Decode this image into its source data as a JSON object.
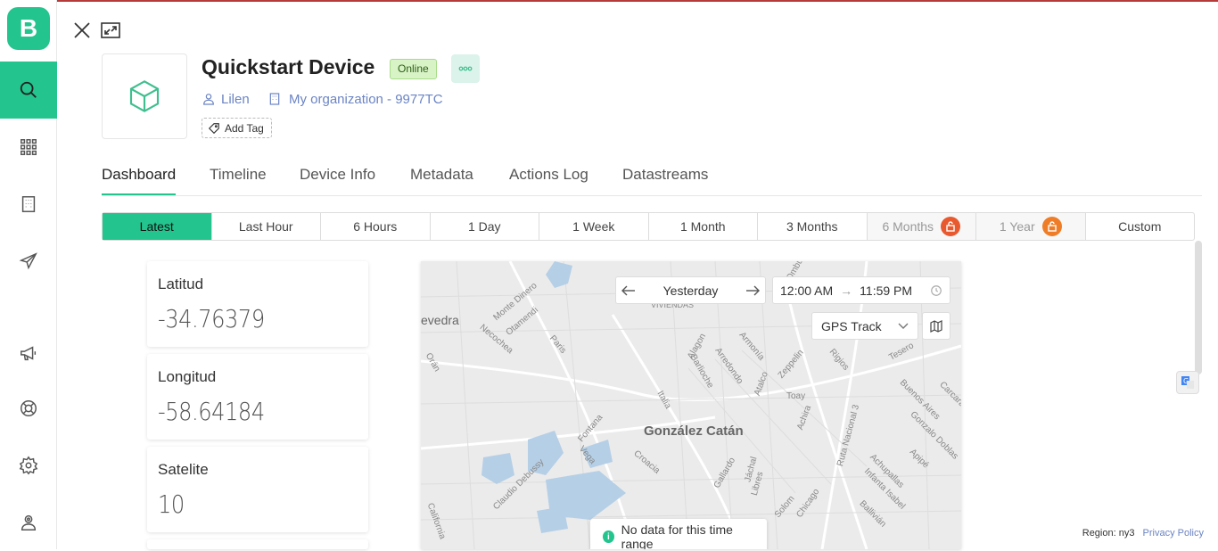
{
  "app": {
    "logo_letter": "B"
  },
  "sidebar": {
    "items": [
      {
        "name": "search",
        "icon": "search-icon",
        "active": true
      },
      {
        "name": "devices",
        "icon": "grid-icon",
        "active": false
      },
      {
        "name": "organizations",
        "icon": "building-icon",
        "active": false
      },
      {
        "name": "messages",
        "icon": "send-icon",
        "active": false
      },
      {
        "name": "announcements",
        "icon": "megaphone-icon",
        "active": false
      },
      {
        "name": "help",
        "icon": "lifebuoy-icon",
        "active": false
      },
      {
        "name": "settings",
        "icon": "gear-icon",
        "active": false
      },
      {
        "name": "profile",
        "icon": "user-badge-icon",
        "active": false
      }
    ]
  },
  "device": {
    "title": "Quickstart Device",
    "status": "Online",
    "owner": "Lilen",
    "organization": "My organization - 9977TC",
    "add_tag": "Add Tag"
  },
  "tabs": [
    "Dashboard",
    "Timeline",
    "Device Info",
    "Metadata",
    "Actions Log",
    "Datastreams"
  ],
  "active_tab": "Dashboard",
  "time_ranges": [
    {
      "label": "Latest",
      "active": true,
      "locked": false
    },
    {
      "label": "Last Hour",
      "active": false,
      "locked": false
    },
    {
      "label": "6 Hours",
      "active": false,
      "locked": false
    },
    {
      "label": "1 Day",
      "active": false,
      "locked": false
    },
    {
      "label": "1 Week",
      "active": false,
      "locked": false
    },
    {
      "label": "1 Month",
      "active": false,
      "locked": false
    },
    {
      "label": "3 Months",
      "active": false,
      "locked": false
    },
    {
      "label": "6 Months",
      "active": false,
      "locked": true
    },
    {
      "label": "1 Year",
      "active": false,
      "locked": true
    },
    {
      "label": "Custom",
      "active": false,
      "locked": false
    }
  ],
  "cards": [
    {
      "label": "Latitud",
      "value": "-34.76379"
    },
    {
      "label": "Longitud",
      "value": "-58.64184"
    },
    {
      "label": "Satelite",
      "value": "10"
    }
  ],
  "map": {
    "date": "Yesterday",
    "time_from": "12:00 AM",
    "time_to": "11:59 PM",
    "track_mode": "GPS Track",
    "nodata": "No data for this time range",
    "city_label": "González Catán",
    "place_labels": [
      "evedra",
      "Necochea",
      "Monte Dinero",
      "Otamendi",
      "Paris",
      "Orán",
      "Italia",
      "Fontana",
      "Vega",
      "Croacia",
      "Claudio Debussy",
      "Alagon",
      "Barlioche",
      "Arredondo",
      "Armonía",
      "Atalco",
      "Zeppelin",
      "Rigios",
      "Toay",
      "Achira",
      "Ruta Nacional 3",
      "Buenos Aires",
      "Gonzalo Doblas",
      "Achupallas",
      "Infanta Isabel",
      "Ballivián",
      "Gallardo",
      "Jáchal",
      "Libres",
      "Solom",
      "Chicago",
      "Apipé",
      "VIVIENDAS",
      "Carcara",
      "Tesero",
      "Ombú",
      "California"
    ],
    "colors": {
      "water": "#b5cfe6",
      "road": "#ffffff",
      "land": "#ebebeb"
    }
  },
  "footer": {
    "region": "Region: ny3",
    "privacy": "Privacy Policy"
  },
  "colors": {
    "accent": "#23c48e",
    "link": "#6b84c4",
    "lock": "#e8592f"
  }
}
